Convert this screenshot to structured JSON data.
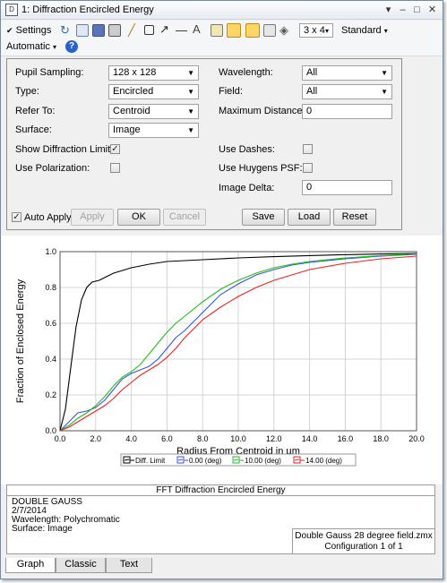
{
  "window": {
    "title": "1: Diffraction Encircled Energy",
    "icon_glyph": "D"
  },
  "toolbar": {
    "settings_label": "Settings",
    "layout_value": "3 x 4",
    "standard_label": "Standard",
    "automatic_label": "Automatic"
  },
  "panel": {
    "pupil_sampling": {
      "label": "Pupil Sampling:",
      "value": "128 x 128"
    },
    "type": {
      "label": "Type:",
      "value": "Encircled"
    },
    "refer_to": {
      "label": "Refer To:",
      "value": "Centroid"
    },
    "surface": {
      "label": "Surface:",
      "value": "Image"
    },
    "show_diff_limit": {
      "label": "Show Diffraction Limit:",
      "checked": true
    },
    "use_polarization": {
      "label": "Use Polarization:",
      "checked": false
    },
    "wavelength": {
      "label": "Wavelength:",
      "value": "All"
    },
    "field": {
      "label": "Field:",
      "value": "All"
    },
    "max_distance": {
      "label": "Maximum Distance:",
      "value": "0"
    },
    "use_dashes": {
      "label": "Use Dashes:",
      "checked": false
    },
    "use_huygens": {
      "label": "Use Huygens PSF:",
      "checked": false
    },
    "image_delta": {
      "label": "Image Delta:",
      "value": "0"
    },
    "auto_apply": {
      "label": "Auto Apply",
      "checked": true
    },
    "buttons": {
      "apply": "Apply",
      "ok": "OK",
      "cancel": "Cancel",
      "save": "Save",
      "load": "Load",
      "reset": "Reset"
    }
  },
  "chart_data": {
    "type": "line",
    "xlabel": "Radius From Centroid in µm",
    "ylabel": "Fraction of Enclosed Energy",
    "xlim": [
      0,
      20
    ],
    "ylim": [
      0,
      1
    ],
    "x_ticks": [
      "0.0",
      "2.0",
      "4.0",
      "6.0",
      "8.0",
      "10.0",
      "12.0",
      "14.0",
      "16.0",
      "18.0",
      "20.0"
    ],
    "y_ticks": [
      "0.0",
      "0.2",
      "0.4",
      "0.6",
      "0.8",
      "1.0"
    ],
    "grid": true,
    "legend_position": "bottom",
    "series": [
      {
        "name": "Diff. Limit",
        "color": "#000000",
        "x": [
          0,
          0.3,
          0.6,
          0.9,
          1.2,
          1.5,
          1.8,
          2.2,
          2.6,
          3.0,
          4.0,
          5.0,
          6.0,
          8.0,
          10.0,
          12.0,
          14.0,
          16.0,
          18.0,
          20.0
        ],
        "y": [
          0,
          0.12,
          0.35,
          0.58,
          0.73,
          0.8,
          0.83,
          0.84,
          0.86,
          0.88,
          0.91,
          0.93,
          0.945,
          0.955,
          0.965,
          0.972,
          0.978,
          0.983,
          0.987,
          0.99
        ]
      },
      {
        "name": "0.00 (deg)",
        "color": "#3355dd",
        "x": [
          0,
          0.5,
          1.0,
          1.5,
          2.0,
          2.5,
          3.0,
          3.5,
          4.0,
          4.5,
          5.0,
          5.5,
          6.0,
          6.5,
          7.0,
          8.0,
          9.0,
          10.0,
          11.0,
          12.0,
          13.0,
          14.0,
          16.0,
          18.0,
          20.0
        ],
        "y": [
          0,
          0.05,
          0.1,
          0.11,
          0.13,
          0.17,
          0.23,
          0.29,
          0.32,
          0.34,
          0.36,
          0.4,
          0.46,
          0.52,
          0.56,
          0.66,
          0.76,
          0.82,
          0.87,
          0.9,
          0.925,
          0.94,
          0.96,
          0.975,
          0.985
        ]
      },
      {
        "name": "10.00 (deg)",
        "color": "#22bb22",
        "x": [
          0,
          0.5,
          1.0,
          1.5,
          2.0,
          2.5,
          3.0,
          3.5,
          4.0,
          4.5,
          5.0,
          5.5,
          6.0,
          6.5,
          7.0,
          8.0,
          9.0,
          10.0,
          11.0,
          12.0,
          13.0,
          14.0,
          16.0,
          18.0,
          20.0
        ],
        "y": [
          0,
          0.03,
          0.07,
          0.1,
          0.14,
          0.19,
          0.25,
          0.3,
          0.33,
          0.37,
          0.43,
          0.49,
          0.55,
          0.6,
          0.64,
          0.72,
          0.79,
          0.84,
          0.88,
          0.91,
          0.93,
          0.945,
          0.965,
          0.978,
          0.987
        ]
      },
      {
        "name": "14.00 (deg)",
        "color": "#ee2222",
        "x": [
          0,
          0.5,
          1.0,
          1.5,
          2.0,
          2.5,
          3.0,
          3.5,
          4.0,
          4.5,
          5.0,
          5.5,
          6.0,
          6.5,
          7.0,
          8.0,
          9.0,
          10.0,
          11.0,
          12.0,
          13.0,
          14.0,
          16.0,
          18.0,
          20.0
        ],
        "y": [
          0,
          0.02,
          0.05,
          0.08,
          0.11,
          0.14,
          0.18,
          0.23,
          0.27,
          0.31,
          0.34,
          0.37,
          0.41,
          0.46,
          0.52,
          0.62,
          0.69,
          0.75,
          0.8,
          0.84,
          0.87,
          0.9,
          0.935,
          0.96,
          0.975
        ]
      }
    ]
  },
  "info": {
    "title": "FFT Diffraction Encircled Energy",
    "lines": [
      "DOUBLE GAUSS",
      "2/7/2014",
      "Wavelength: Polychromatic",
      "Surface: Image"
    ],
    "file": "Double Gauss 28 degree field.zmx",
    "config": "Configuration 1 of 1"
  },
  "tabs": [
    "Graph",
    "Classic",
    "Text"
  ]
}
